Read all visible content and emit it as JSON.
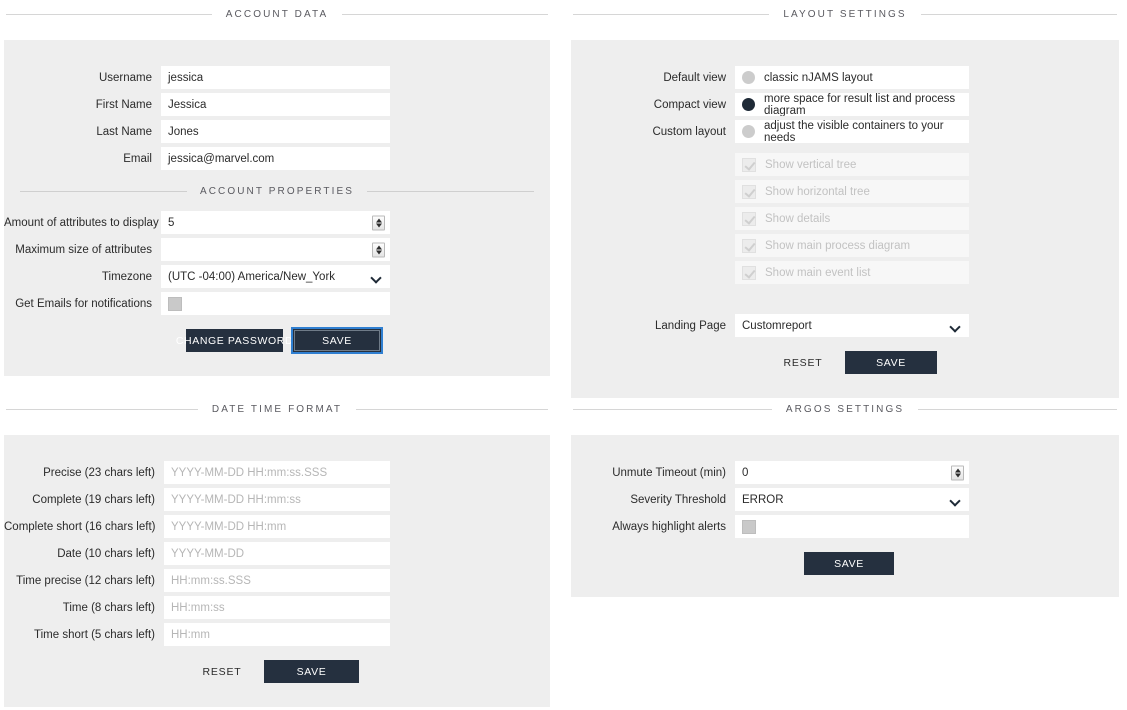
{
  "sections": {
    "account_data": {
      "title": "Account Data"
    },
    "account_properties": {
      "title": "Account Properties"
    },
    "layout_settings": {
      "title": "Layout Settings"
    },
    "date_time_format": {
      "title": "Date Time Format"
    },
    "argos_settings": {
      "title": "Argos Settings"
    }
  },
  "account_data": {
    "fields": [
      {
        "label": "Username",
        "value": "jessica"
      },
      {
        "label": "First Name",
        "value": "Jessica"
      },
      {
        "label": "Last Name",
        "value": "Jones"
      },
      {
        "label": "Email",
        "value": "jessica@marvel.com"
      }
    ]
  },
  "account_properties": {
    "amount_attributes": {
      "label": "Amount of attributes to display",
      "value": "5"
    },
    "max_size_attributes": {
      "label": "Maximum size of attributes",
      "value": ""
    },
    "timezone": {
      "label": "Timezone",
      "value": "(UTC -04:00) America/New_York"
    },
    "get_emails": {
      "label": "Get Emails for notifications",
      "checked": false
    },
    "change_password_label": "CHANGE PASSWORD",
    "save_label": "SAVE"
  },
  "layout_settings": {
    "options": [
      {
        "label": "Default view",
        "description": "classic nJAMS layout",
        "selected": false
      },
      {
        "label": "Compact view",
        "description": "more space for result list and process diagram",
        "selected": true
      },
      {
        "label": "Custom layout",
        "description": "adjust the visible containers to your needs",
        "selected": false
      }
    ],
    "custom_checkboxes": [
      {
        "label": "Show vertical tree",
        "checked": true,
        "disabled": true
      },
      {
        "label": "Show horizontal tree",
        "checked": true,
        "disabled": true
      },
      {
        "label": "Show details",
        "checked": true,
        "disabled": true
      },
      {
        "label": "Show main process diagram",
        "checked": true,
        "disabled": true
      },
      {
        "label": "Show main event list",
        "checked": true,
        "disabled": true
      }
    ],
    "landing_page": {
      "label": "Landing Page",
      "value": "Customreport"
    },
    "reset_label": "RESET",
    "save_label": "SAVE"
  },
  "date_time_format": {
    "fields": [
      {
        "label": "Precise (23 chars left)",
        "placeholder": "YYYY-MM-DD HH:mm:ss.SSS"
      },
      {
        "label": "Complete (19 chars left)",
        "placeholder": "YYYY-MM-DD HH:mm:ss"
      },
      {
        "label": "Complete short (16 chars left)",
        "placeholder": "YYYY-MM-DD HH:mm"
      },
      {
        "label": "Date (10 chars left)",
        "placeholder": "YYYY-MM-DD"
      },
      {
        "label": "Time precise (12 chars left)",
        "placeholder": "HH:mm:ss.SSS"
      },
      {
        "label": "Time (8 chars left)",
        "placeholder": "HH:mm:ss"
      },
      {
        "label": "Time short (5 chars left)",
        "placeholder": "HH:mm"
      }
    ],
    "reset_label": "RESET",
    "save_label": "SAVE"
  },
  "argos_settings": {
    "unmute_timeout": {
      "label": "Unmute Timeout (min)",
      "value": "0"
    },
    "severity_threshold": {
      "label": "Severity Threshold",
      "value": "ERROR"
    },
    "always_highlight": {
      "label": "Always highlight alerts",
      "checked": false
    },
    "save_label": "SAVE"
  },
  "colors": {
    "panel_bg": "#eeeeee",
    "button_dark": "#25303f",
    "radio_selected": "#1f2a37",
    "focus_outline": "#2f7fd1",
    "page_bg": "#ffffff"
  }
}
